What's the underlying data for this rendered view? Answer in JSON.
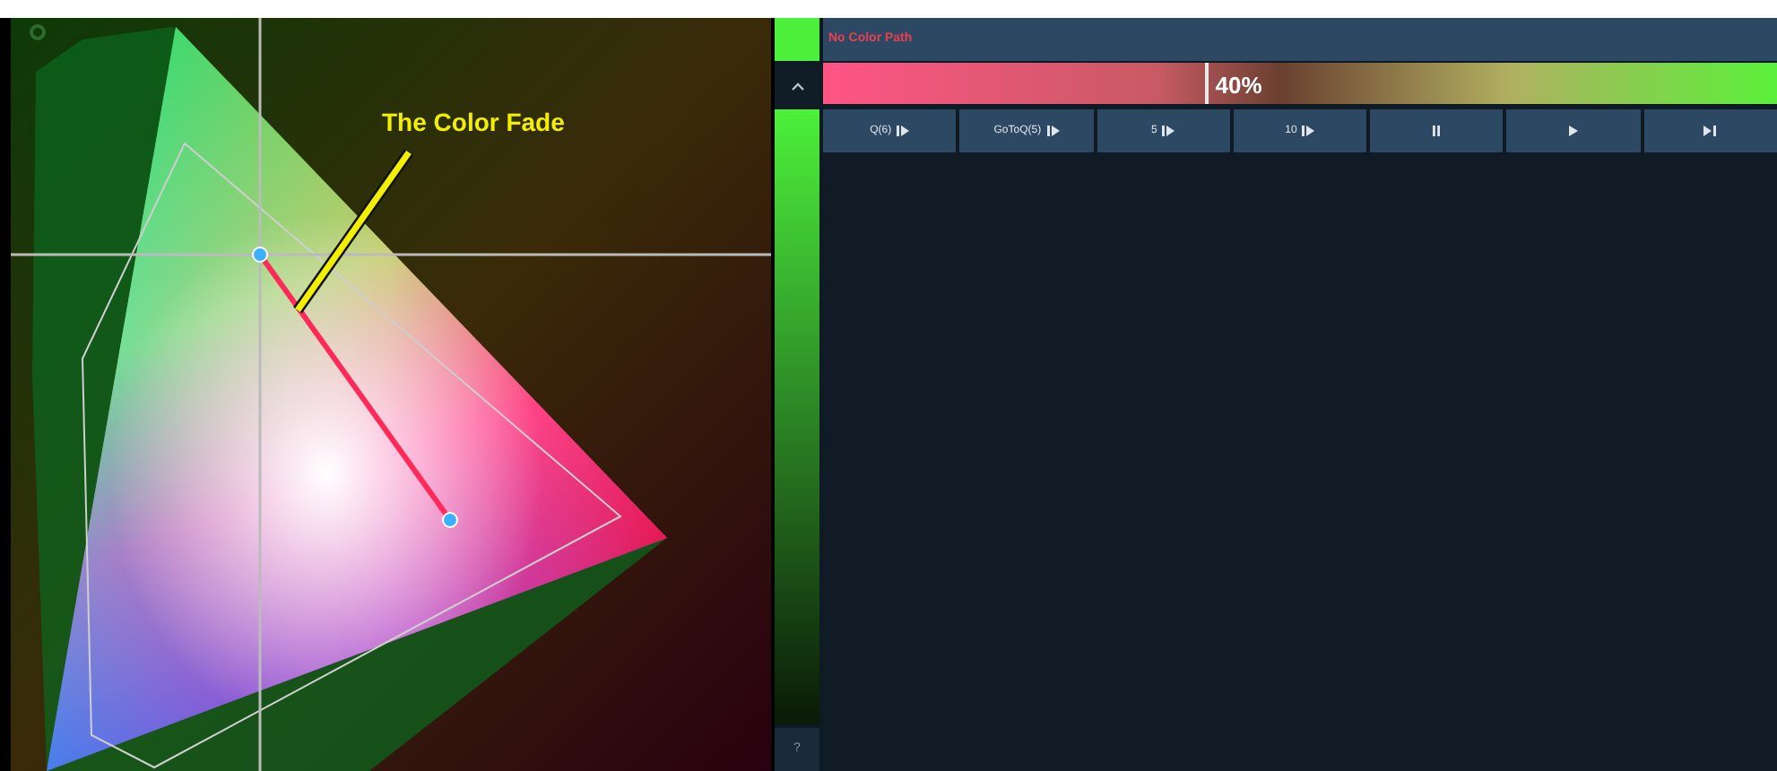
{
  "diagram": {
    "annotation": "The Color Fade"
  },
  "color_path": {
    "title": "No Color Path"
  },
  "fader": {
    "level": 0.4,
    "reading": "40%"
  },
  "buttons": [
    {
      "label": "Q(6)",
      "kind": "step"
    },
    {
      "label": "GoToQ(5)",
      "kind": "step"
    },
    {
      "label": "5",
      "kind": "step"
    },
    {
      "label": "10",
      "kind": "step"
    },
    {
      "kind": "pause"
    },
    {
      "kind": "play"
    },
    {
      "kind": "skip"
    }
  ],
  "side": {
    "help": "?"
  }
}
